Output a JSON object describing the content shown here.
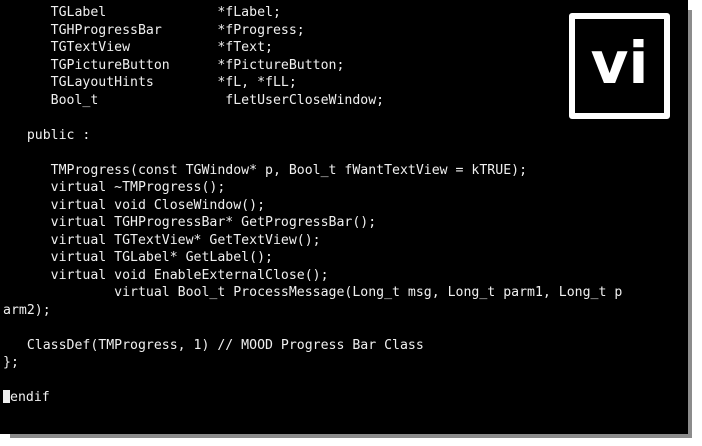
{
  "editor": {
    "name": "vi",
    "theme": {
      "background": "#000000",
      "foreground": "#f0f0f0",
      "badge_border": "#ffffff",
      "shadow": "#8c8c8c"
    },
    "lines": [
      "      TGLabel              *fLabel;",
      "      TGHProgressBar       *fProgress;",
      "      TGTextView           *fText;",
      "      TGPictureButton      *fPictureButton;",
      "      TGLayoutHints        *fL, *fLL;",
      "      Bool_t                fLetUserCloseWindow;",
      "",
      "   public :",
      "",
      "      TMProgress(const TGWindow* p, Bool_t fWantTextView = kTRUE);",
      "      virtual ~TMProgress();",
      "      virtual void CloseWindow();",
      "      virtual TGHProgressBar* GetProgressBar();",
      "      virtual TGTextView* GetTextView();",
      "      virtual TGLabel* GetLabel();",
      "      virtual void EnableExternalClose();",
      "              virtual Bool_t ProcessMessage(Long_t msg, Long_t parm1, Long_t p",
      "arm2);",
      "",
      "   ClassDef(TMProgress, 1) // MOOD Progress Bar Class",
      "};",
      "",
      "#endif"
    ]
  }
}
